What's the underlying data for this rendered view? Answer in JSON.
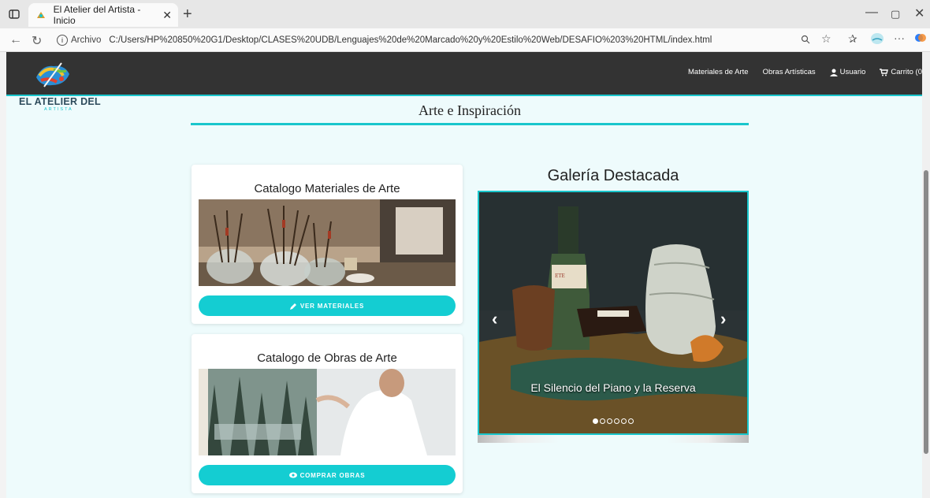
{
  "browser": {
    "tab_title": "El Atelier del Artista - Inicio",
    "address_label": "Archivo",
    "url": "C:/Users/HP%20850%20G1/Desktop/CLASES%20UDB/Lenguajes%20de%20Marcado%20y%20Estilo%20Web/DESAFIO%203%20HTML/index.html"
  },
  "site": {
    "brand_name": "EL ATELIER DEL",
    "brand_sub": "ARTISTA",
    "nav": [
      {
        "label": "Materiales de Arte",
        "icon": ""
      },
      {
        "label": "Obras Artísticas",
        "icon": ""
      },
      {
        "label": "Usuario",
        "icon": "user-icon"
      },
      {
        "label": "Carrito (0",
        "icon": "cart-icon"
      }
    ],
    "hero_title": "Arte e Inspiración"
  },
  "cards": [
    {
      "title": "Catalogo Materiales de Arte",
      "button": "VER MATERIALES",
      "button_icon": "pencil-icon"
    },
    {
      "title": "Catalogo de Obras de Arte",
      "button": "COMPRAR OBRAS",
      "button_icon": "eye-icon"
    }
  ],
  "gallery": {
    "title": "Galería Destacada",
    "caption": "El Silencio del Piano y la Reserva",
    "slide_count": 6,
    "active_slide": 1
  },
  "colors": {
    "accent": "#19c6cc",
    "button": "#14cdd2",
    "header": "#333333",
    "page_bg": "#eefbfc"
  }
}
